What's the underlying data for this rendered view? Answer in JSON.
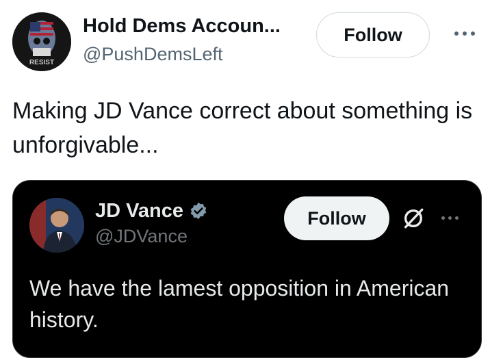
{
  "post": {
    "author": {
      "display_name": "Hold Dems Accoun...",
      "handle": "@PushDemsLeft",
      "avatar_text": "RESIST"
    },
    "follow_label": "Follow",
    "more_icon": "more-horizontal-icon",
    "text": "Making JD Vance correct about something is unforgivable..."
  },
  "quoted": {
    "author": {
      "display_name": "JD Vance",
      "handle": "@JDVance",
      "verified_icon": "verified-badge-icon"
    },
    "follow_label": "Follow",
    "grok_icon": "grok-icon",
    "more_icon": "more-horizontal-icon",
    "text": "We have the lamest opposition in American history."
  },
  "colors": {
    "primary_text": "#0f1419",
    "secondary_text": "#536471",
    "card_bg": "#000000",
    "card_text": "#e7e9ea",
    "card_secondary": "#71767b",
    "verified": "#829aab"
  }
}
